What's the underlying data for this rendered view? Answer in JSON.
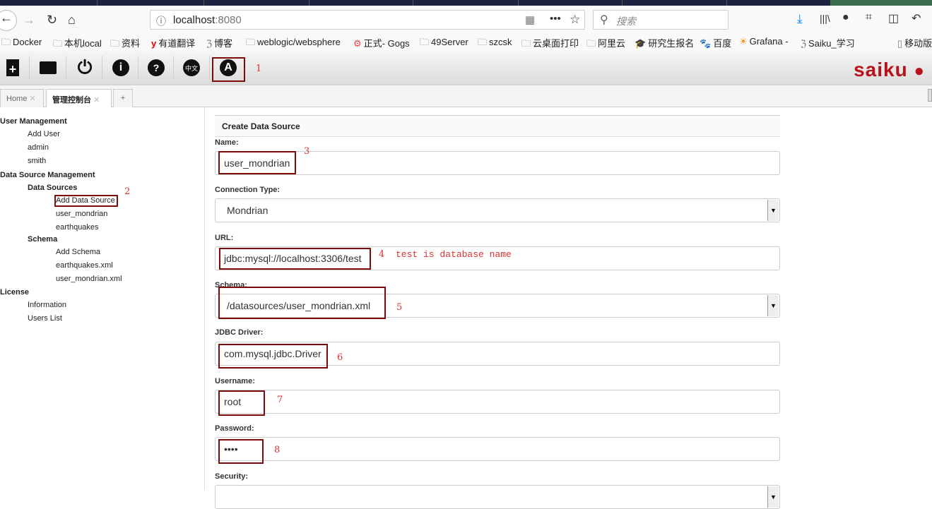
{
  "browser": {
    "url_host": "localhost",
    "url_port": ":8080",
    "search_placeholder": "搜索"
  },
  "bookmarks": [
    "Docker",
    "本机local",
    "资料",
    "有道翻译",
    "博客",
    "weblogic/websphere",
    "正式- Gogs",
    "49Server",
    "szcsk",
    "云桌面打印",
    "阿里云",
    "研究生报名",
    "百度",
    "Grafana -",
    "Saiku_学习",
    "移动版"
  ],
  "toolbar": {
    "icons": [
      "new-query-icon",
      "open-icon",
      "logout-icon",
      "about-icon",
      "help-icon",
      "language-icon",
      "admin-icon"
    ],
    "language_label": "中文",
    "admin_label": "A",
    "logo": "saiku"
  },
  "tabs": [
    {
      "label": "Home"
    },
    {
      "label": "管理控制台"
    },
    {
      "label": "+"
    }
  ],
  "sidebar": {
    "user_management": "User Management",
    "add_user": "Add User",
    "users": [
      "admin",
      "smith"
    ],
    "data_source_management": "Data Source Management",
    "data_sources": "Data Sources",
    "add_data_source": "Add Data Source",
    "sources": [
      "user_mondrian",
      "earthquakes"
    ],
    "schema": "Schema",
    "add_schema": "Add Schema",
    "schemas": [
      "earthquakes.xml",
      "user_mondrian.xml"
    ],
    "license": "License",
    "information": "Information",
    "users_list": "Users List"
  },
  "form": {
    "title": "Create Data Source",
    "name_label": "Name:",
    "name_value": "user_mondrian",
    "conn_label": "Connection Type:",
    "conn_value": "Mondrian",
    "url_label": "URL:",
    "url_value": "jdbc:mysql://localhost:3306/test",
    "schema_label": "Schema:",
    "schema_value": "/datasources/user_mondrian.xml",
    "driver_label": "JDBC Driver:",
    "driver_value": "com.mysql.jdbc.Driver",
    "username_label": "Username:",
    "username_value": "root",
    "password_label": "Password:",
    "password_value": "••••",
    "security_label": "Security:"
  },
  "annotations": {
    "a1": "1",
    "a2": "2",
    "a3": "3",
    "a4": "4",
    "a4_note": "test is database name",
    "a5": "5",
    "a6": "6",
    "a7": "7",
    "a8": "8",
    "color": "#e03030"
  }
}
